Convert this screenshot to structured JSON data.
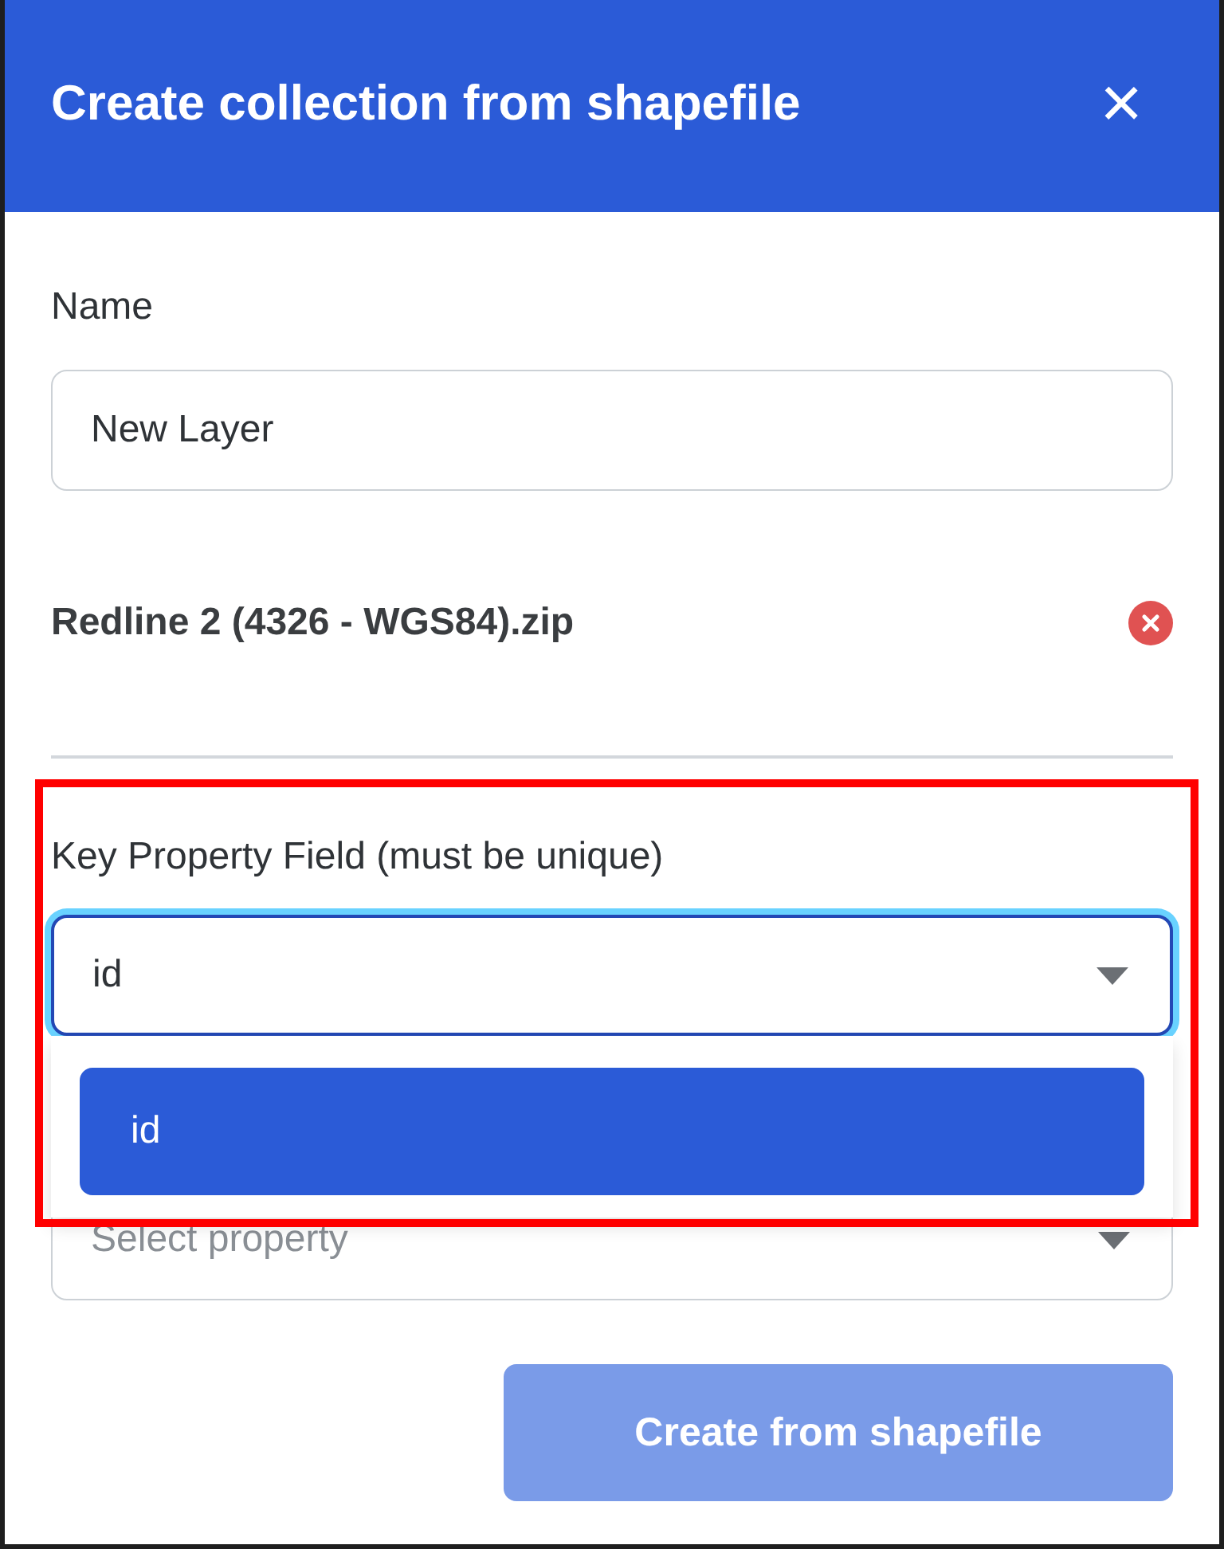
{
  "dialog": {
    "title": "Create collection from shapefile",
    "close_symbol": "×"
  },
  "name_field": {
    "label": "Name",
    "value": "New Layer"
  },
  "file": {
    "name": "Redline 2 (4326 - WGS84).zip"
  },
  "key_field": {
    "label": "Key Property Field (must be unique)",
    "value": "id",
    "open": true,
    "options": [
      {
        "label": "id",
        "selected": true
      }
    ]
  },
  "second_field": {
    "placeholder": "Select property"
  },
  "submit": {
    "label": "Create from shapefile",
    "disabled": true
  },
  "highlight_frame": true
}
